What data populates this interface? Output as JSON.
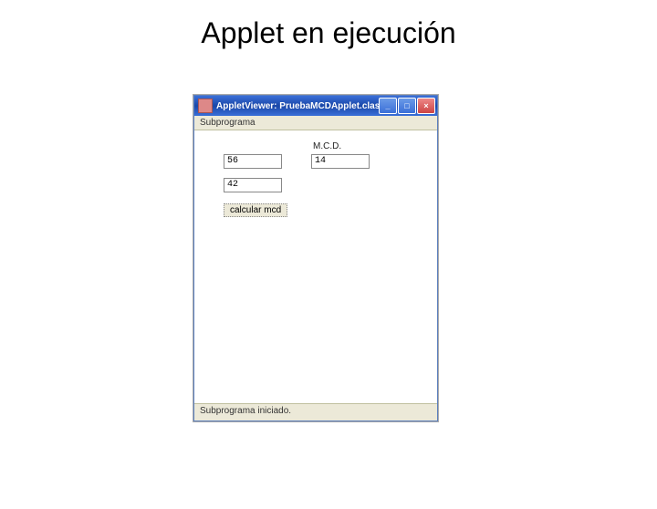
{
  "slide": {
    "title": "Applet en ejecución"
  },
  "window": {
    "title": "AppletViewer: PruebaMCDApplet.class",
    "menu": "Subprograma",
    "status": "Subprograma iniciado."
  },
  "applet": {
    "mcd_label": "M.C.D.",
    "input_a": "56",
    "input_b": "42",
    "result": "14",
    "button_label": "calcular mcd"
  },
  "win_controls": {
    "min": "_",
    "max": "□",
    "close": "×"
  }
}
